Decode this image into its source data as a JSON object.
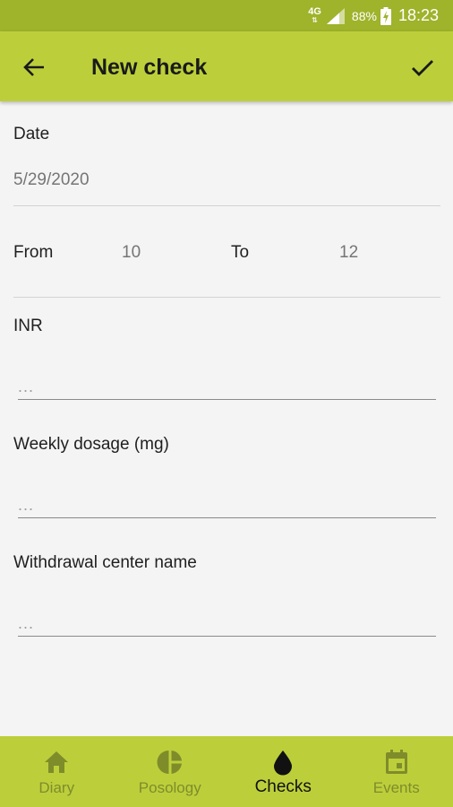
{
  "status_bar": {
    "network": "4G",
    "battery": "88%",
    "time": "18:23"
  },
  "app_bar": {
    "title": "New check",
    "back_icon": "arrow-left-icon",
    "confirm_icon": "checkmark-icon"
  },
  "form": {
    "date_label": "Date",
    "date_value": "5/29/2020",
    "from_label": "From",
    "from_value": "10",
    "to_label": "To",
    "to_value": "12",
    "inr_label": "INR",
    "inr_placeholder": "...",
    "weekly_label": "Weekly dosage (mg)",
    "weekly_placeholder": "...",
    "center_label": "Withdrawal center name",
    "center_placeholder": "..."
  },
  "bottom_nav": {
    "items": [
      {
        "label": "Diary",
        "icon": "home-icon",
        "active": false
      },
      {
        "label": "Posology",
        "icon": "pie-chart-icon",
        "active": false
      },
      {
        "label": "Checks",
        "icon": "drop-icon",
        "active": true
      },
      {
        "label": "Events",
        "icon": "calendar-icon",
        "active": false
      }
    ]
  },
  "colors": {
    "status_bar": "#9fb32b",
    "app_bar": "#bccf3b",
    "background": "#f4f4f4",
    "nav_inactive": "#7f8c2a"
  }
}
